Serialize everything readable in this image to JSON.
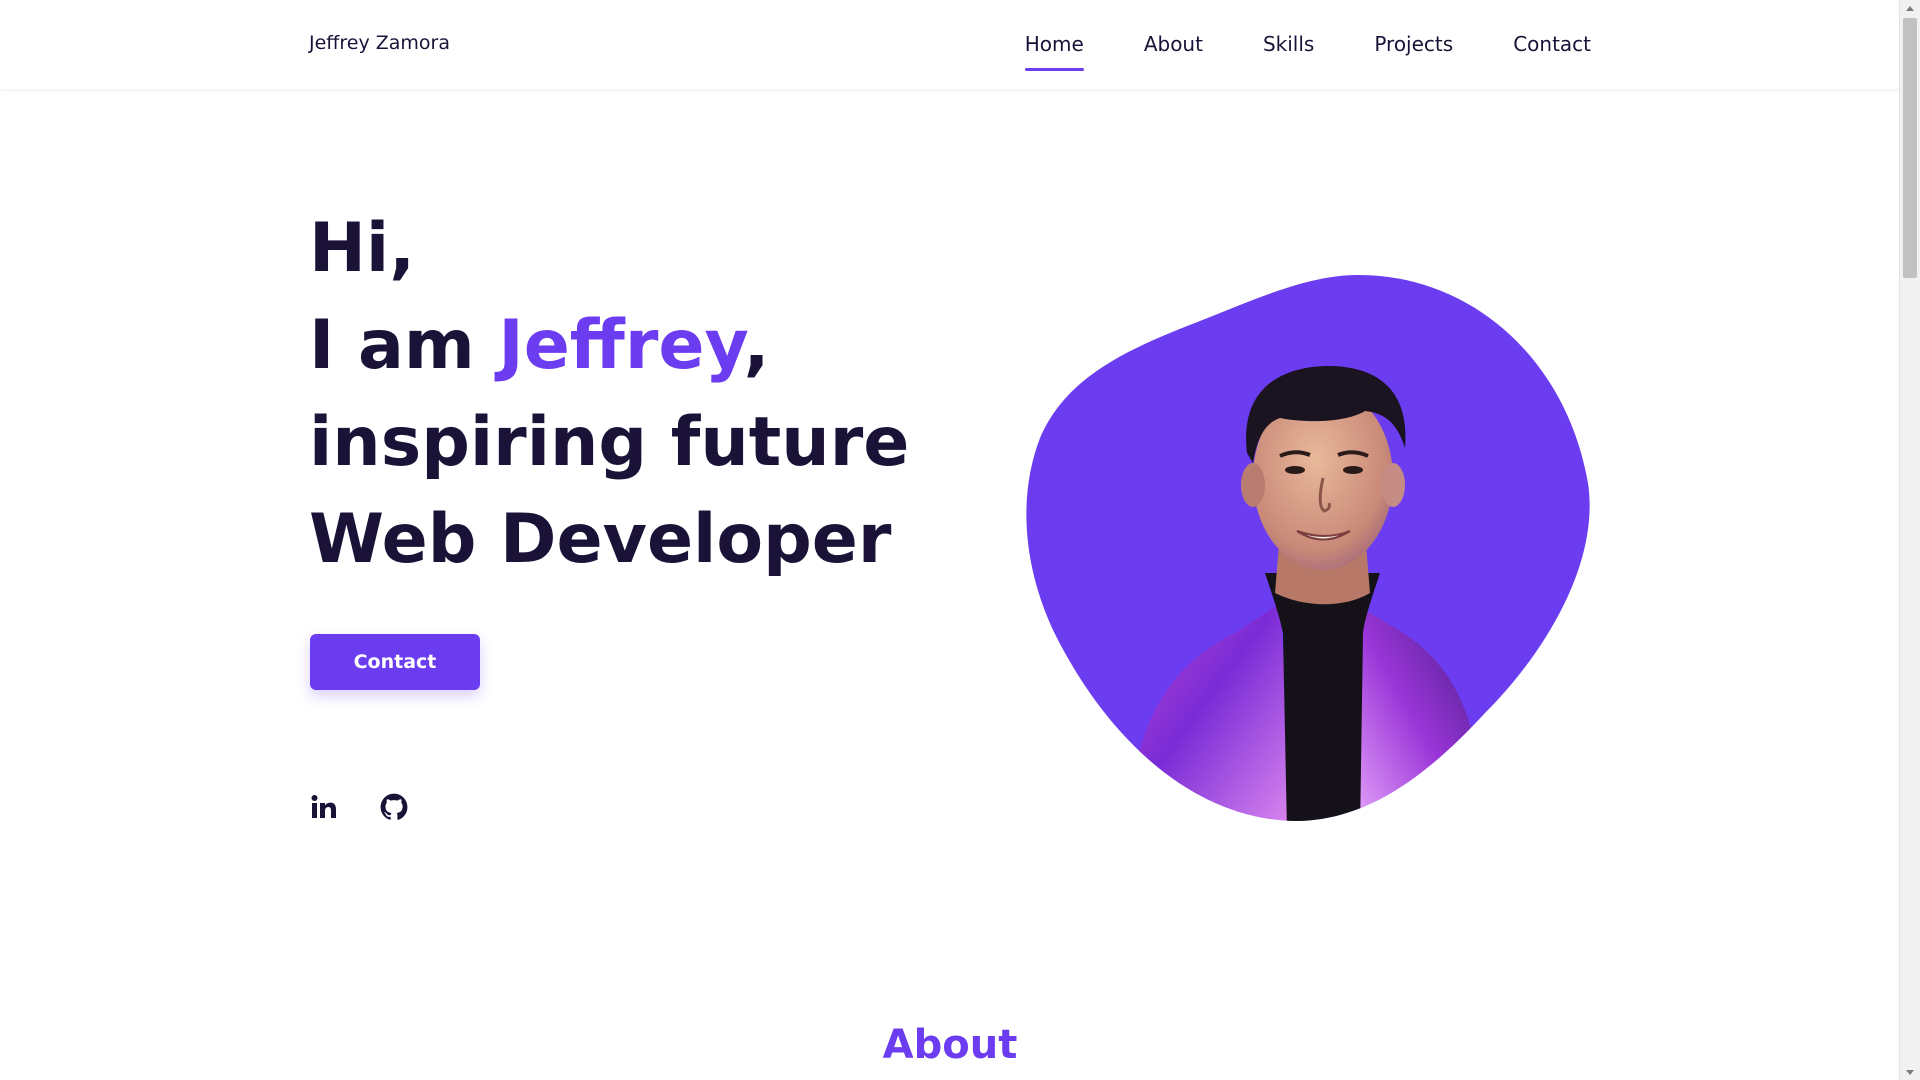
{
  "header": {
    "brand": "Jeffrey Zamora",
    "nav": [
      {
        "label": "Home",
        "active": true
      },
      {
        "label": "About",
        "active": false
      },
      {
        "label": "Skills",
        "active": false
      },
      {
        "label": "Projects",
        "active": false
      },
      {
        "label": "Contact",
        "active": false
      }
    ]
  },
  "hero": {
    "line1": "Hi,",
    "line2_prefix": "I am ",
    "line2_name": "Jeffrey",
    "line2_suffix": ",",
    "line3": "inspiring future",
    "line4": "Web Developer",
    "button_label": "Contact",
    "socials": [
      {
        "icon": "linkedin-icon"
      },
      {
        "icon": "github-icon"
      }
    ],
    "portrait_icon": "profile-photo"
  },
  "about": {
    "title": "About"
  },
  "colors": {
    "accent": "#6c3cf0",
    "text": "#1b1238",
    "background": "#ffffff"
  }
}
